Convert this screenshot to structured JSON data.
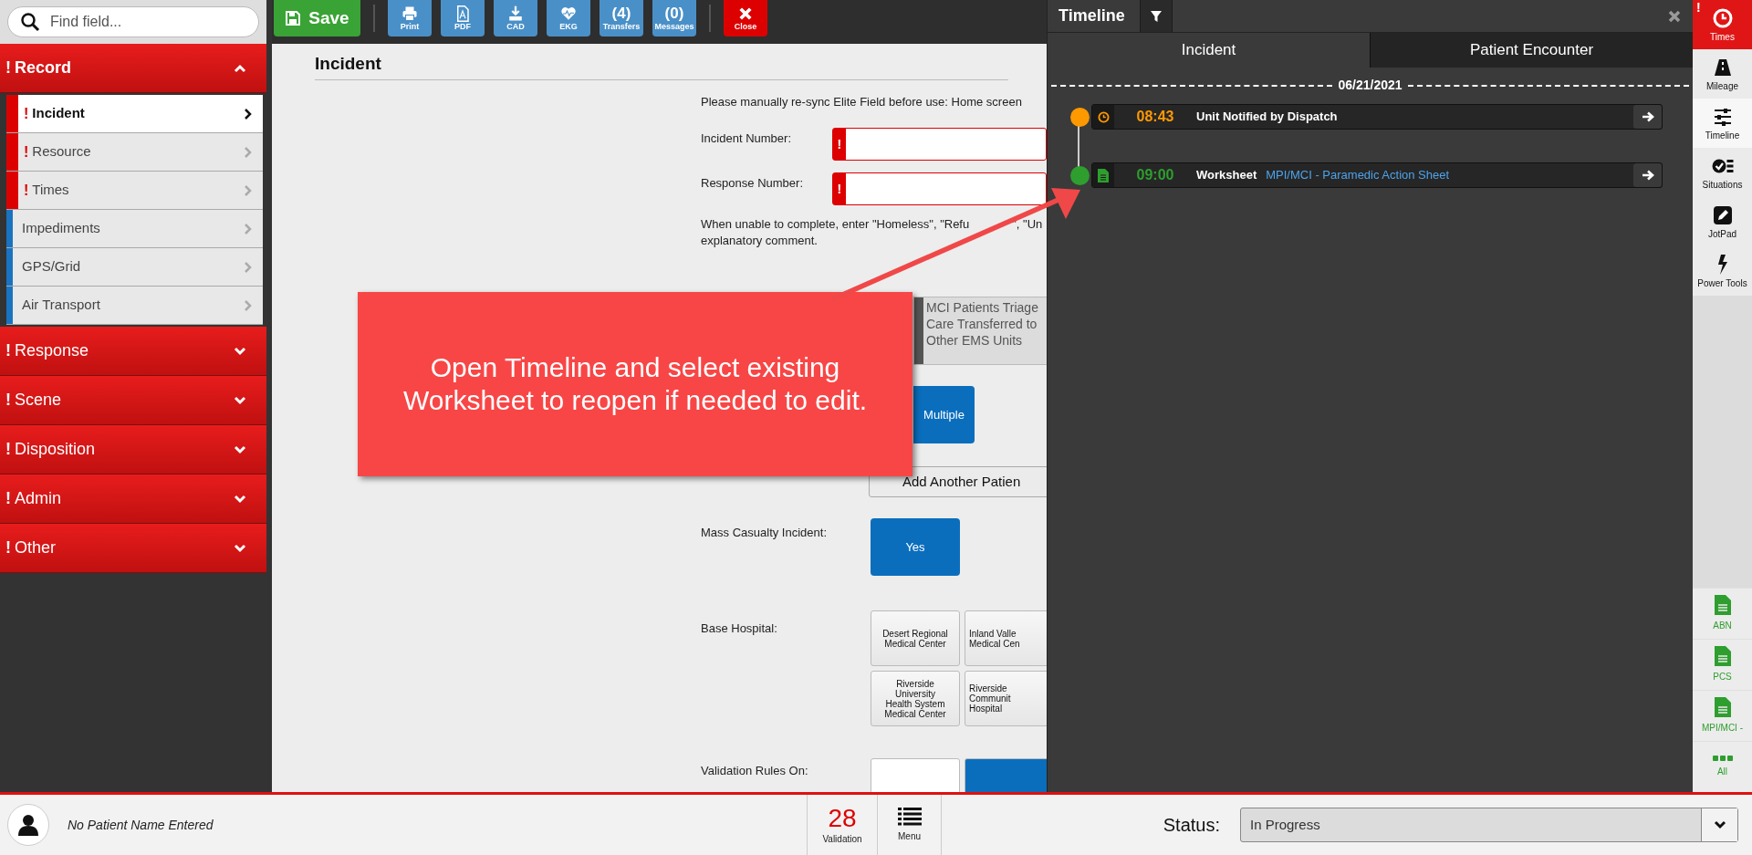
{
  "search": {
    "placeholder": "Find field..."
  },
  "nav": [
    {
      "label": "Record",
      "flag": "!",
      "expanded": true,
      "children": [
        {
          "label": "Incident",
          "flag": "!",
          "selected": true
        },
        {
          "label": "Resource",
          "flag": "!",
          "selected": false
        },
        {
          "label": "Times",
          "flag": "!",
          "selected": false
        },
        {
          "label": "Impediments",
          "selected": false
        },
        {
          "label": "GPS/Grid",
          "selected": false
        },
        {
          "label": "Air Transport",
          "selected": false
        }
      ]
    },
    {
      "label": "Response",
      "flag": "!",
      "expanded": false
    },
    {
      "label": "Scene",
      "flag": "!",
      "expanded": false
    },
    {
      "label": "Disposition",
      "flag": "!",
      "expanded": false
    },
    {
      "label": "Admin",
      "flag": "!",
      "expanded": false
    },
    {
      "label": "Other",
      "flag": "!",
      "expanded": false
    }
  ],
  "toolbar": {
    "save": "Save",
    "buttons": [
      {
        "kind": "print",
        "label": "Print"
      },
      {
        "kind": "pdf",
        "label": "PDF"
      },
      {
        "kind": "cad",
        "label": "CAD"
      },
      {
        "kind": "ekg",
        "label": "EKG"
      },
      {
        "kind": "count",
        "count": "(4)",
        "label": "Transfers"
      },
      {
        "kind": "count",
        "count": "(0)",
        "label": "Messages"
      },
      {
        "kind": "close",
        "label": "Close"
      }
    ]
  },
  "form": {
    "title": "Incident",
    "notice": "Please manually re-sync Elite Field before use: Home screen",
    "incident_number": {
      "label": "Incident Number:",
      "flag": "!"
    },
    "response_number": {
      "label": "Response Number:",
      "flag": "!"
    },
    "hint": [
      "When unable to complete, enter \"Homeless\", \"Refu",
      "\", \"Un",
      "explanatory comment."
    ],
    "mci_option": {
      "lines": [
        "MCI Patients Triage",
        "Care Transferred to",
        "Other EMS Units"
      ],
      "selected": false
    },
    "multiple_button": "Multiple",
    "add_patient_button": "Add Another Patien",
    "mass_casualty": {
      "label": "Mass Casualty Incident:",
      "option": "Yes",
      "selected": true
    },
    "base_hospital": {
      "label": "Base Hospital:",
      "options": [
        {
          "lines": [
            "Desert Regional",
            "Medical Center"
          ],
          "selected": false
        },
        {
          "lines": [
            "Inland Valle",
            "Medical Cen"
          ],
          "selected": false
        },
        {
          "lines": [
            "Riverside",
            "University",
            "Health System",
            "Medical Center"
          ],
          "selected": false
        },
        {
          "lines": [
            "Riverside",
            "Communit",
            "Hospital"
          ],
          "selected": false
        }
      ]
    },
    "validation_rules": {
      "label": "Validation Rules On:",
      "options": [
        {
          "selected": false
        },
        {
          "selected": true
        }
      ]
    }
  },
  "annotation": {
    "text": "Open Timeline and select existing Worksheet to reopen if needed to edit."
  },
  "timeline": {
    "title": "Timeline",
    "tabs": [
      {
        "label": "Incident",
        "selected": true
      },
      {
        "label": "Patient Encounter",
        "selected": false
      }
    ],
    "date": "06/21/2021",
    "entries": [
      {
        "kind": "time",
        "color": "#ff9900",
        "time": "08:43",
        "label": "Unit Notified by Dispatch"
      },
      {
        "kind": "worksheet",
        "color": "#2e9e2e",
        "time": "09:00",
        "label": "Worksheet",
        "link": "MPI/MCI - Paramedic Action Sheet"
      }
    ]
  },
  "rail": {
    "tools": [
      {
        "kind": "clock",
        "label": "Times",
        "flag": "!",
        "selected": false
      },
      {
        "kind": "road",
        "label": "Mileage",
        "selected": false
      },
      {
        "kind": "sliders",
        "label": "Timeline",
        "selected": true
      },
      {
        "kind": "checklist",
        "label": "Situations",
        "selected": false
      },
      {
        "kind": "pencil",
        "label": "JotPad",
        "selected": false
      },
      {
        "kind": "bolt",
        "label": "Power Tools",
        "selected": false
      }
    ],
    "documents": [
      {
        "kind": "document",
        "label": "ABN"
      },
      {
        "kind": "document",
        "label": "PCS"
      },
      {
        "kind": "document",
        "label": "MPI/MCI -"
      },
      {
        "kind": "more",
        "label": "All"
      }
    ]
  },
  "footer": {
    "patient": "No Patient Name Entered",
    "validation_count": "28",
    "validation_label": "Validation",
    "menu_label": "Menu",
    "status_label": "Status:",
    "status_value": "In Progress"
  }
}
